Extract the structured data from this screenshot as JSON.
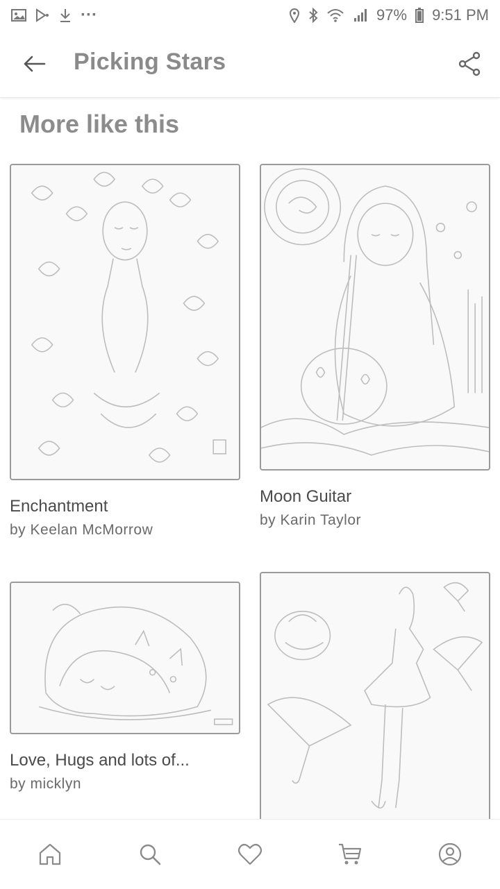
{
  "status_bar": {
    "battery": "97%",
    "time": "9:51 PM",
    "more": "···"
  },
  "app_bar": {
    "title": "Picking Stars"
  },
  "section": {
    "title": "More like this"
  },
  "cards": [
    {
      "title": "Enchantment",
      "author": "by Keelan McMorrow"
    },
    {
      "title": "Moon Guitar",
      "author": "by Karin Taylor"
    },
    {
      "title": "Love, Hugs and lots of...",
      "author": "by micklyn"
    },
    {
      "title": "",
      "author": ""
    }
  ],
  "bottom_nav": {
    "items": [
      "home-icon",
      "search-icon",
      "heart-icon",
      "cart-icon",
      "account-icon"
    ]
  },
  "colors": {
    "icon": "#8a8a8a",
    "title": "#8a8a8a",
    "line_art": "#b8b8b8"
  }
}
